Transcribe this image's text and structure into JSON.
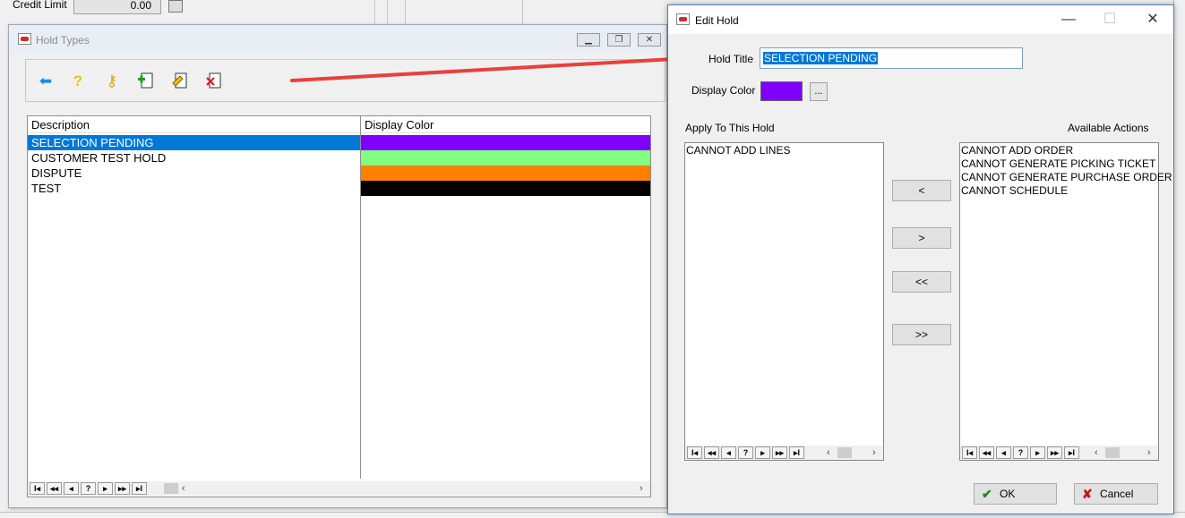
{
  "background_app": {
    "credit_limit_label": "Credit Limit",
    "credit_limit_value": "0.00"
  },
  "hold_types": {
    "title": "Hold Types",
    "icons": [
      "back-arrow-icon",
      "help-icon",
      "key-icon",
      "add-record-icon",
      "edit-record-icon",
      "delete-record-icon"
    ],
    "columns": [
      "Description",
      "Display Color"
    ],
    "rows": [
      {
        "description": "SELECTION PENDING",
        "color": "#8000ff",
        "selected": true
      },
      {
        "description": "CUSTOMER TEST HOLD",
        "color": "#80ff80",
        "selected": false
      },
      {
        "description": "DISPUTE",
        "color": "#ff8000",
        "selected": false
      },
      {
        "description": "TEST",
        "color": "#000000",
        "selected": false
      }
    ],
    "navigator": [
      "I◂",
      "◂◂",
      "◂",
      "?",
      "▸",
      "▸▸",
      "▸I"
    ]
  },
  "edit_hold": {
    "title": "Edit Hold",
    "hold_title_label": "Hold Title",
    "hold_title_value": "SELECTION PENDING",
    "display_color_label": "Display Color",
    "display_color": "#8000ff",
    "ellipsis_label": "...",
    "apply_label": "Apply To This Hold",
    "available_label": "Available Actions",
    "applied_actions": [
      "CANNOT ADD LINES"
    ],
    "available_actions": [
      "CANNOT ADD ORDER",
      "CANNOT GENERATE PICKING TICKET",
      "CANNOT GENERATE PURCHASE ORDER",
      "CANNOT SCHEDULE"
    ],
    "move_buttons": [
      "<",
      ">",
      "<<",
      ">>"
    ],
    "ok_label": "OK",
    "cancel_label": "Cancel",
    "navigator": [
      "I◂",
      "◂◂",
      "◂",
      "?",
      "▸",
      "▸▸",
      "▸I"
    ]
  },
  "colors": {
    "selection": "#0078d7",
    "annotation_arrow": "#e8403c"
  }
}
